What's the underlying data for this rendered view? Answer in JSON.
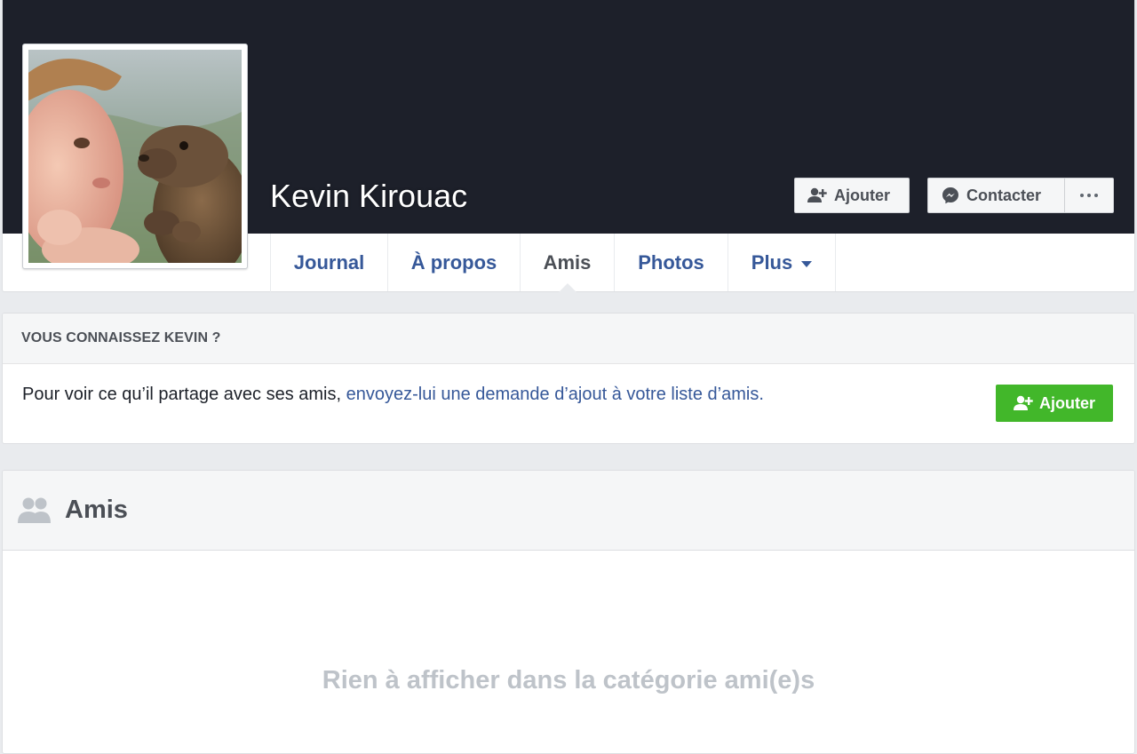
{
  "profile": {
    "name": "Kevin Kirouac",
    "add_label": "Ajouter",
    "contact_label": "Contacter"
  },
  "tabs": [
    {
      "label": "Journal"
    },
    {
      "label": "À propos"
    },
    {
      "label": "Amis"
    },
    {
      "label": "Photos"
    },
    {
      "label": "Plus"
    }
  ],
  "active_tab": "Amis",
  "know": {
    "heading": "VOUS CONNAISSEZ KEVIN ?",
    "text_plain": "Pour voir ce qu’il partage avec ses amis, ",
    "text_link": "envoyez-lui une demande d’ajout à votre liste d’amis.",
    "add_label": "Ajouter"
  },
  "friends": {
    "title": "Amis",
    "empty_message": "Rien à afficher dans la catégorie ami(e)s"
  },
  "icons": {
    "add_friend": "add-friend-icon",
    "messenger": "messenger-icon",
    "more": "more-icon",
    "friends": "friends-icon",
    "caret": "caret-down-icon"
  },
  "colors": {
    "cover": "#1d202a",
    "link": "#365899",
    "green": "#42b72a",
    "muted": "#bec3c9"
  }
}
